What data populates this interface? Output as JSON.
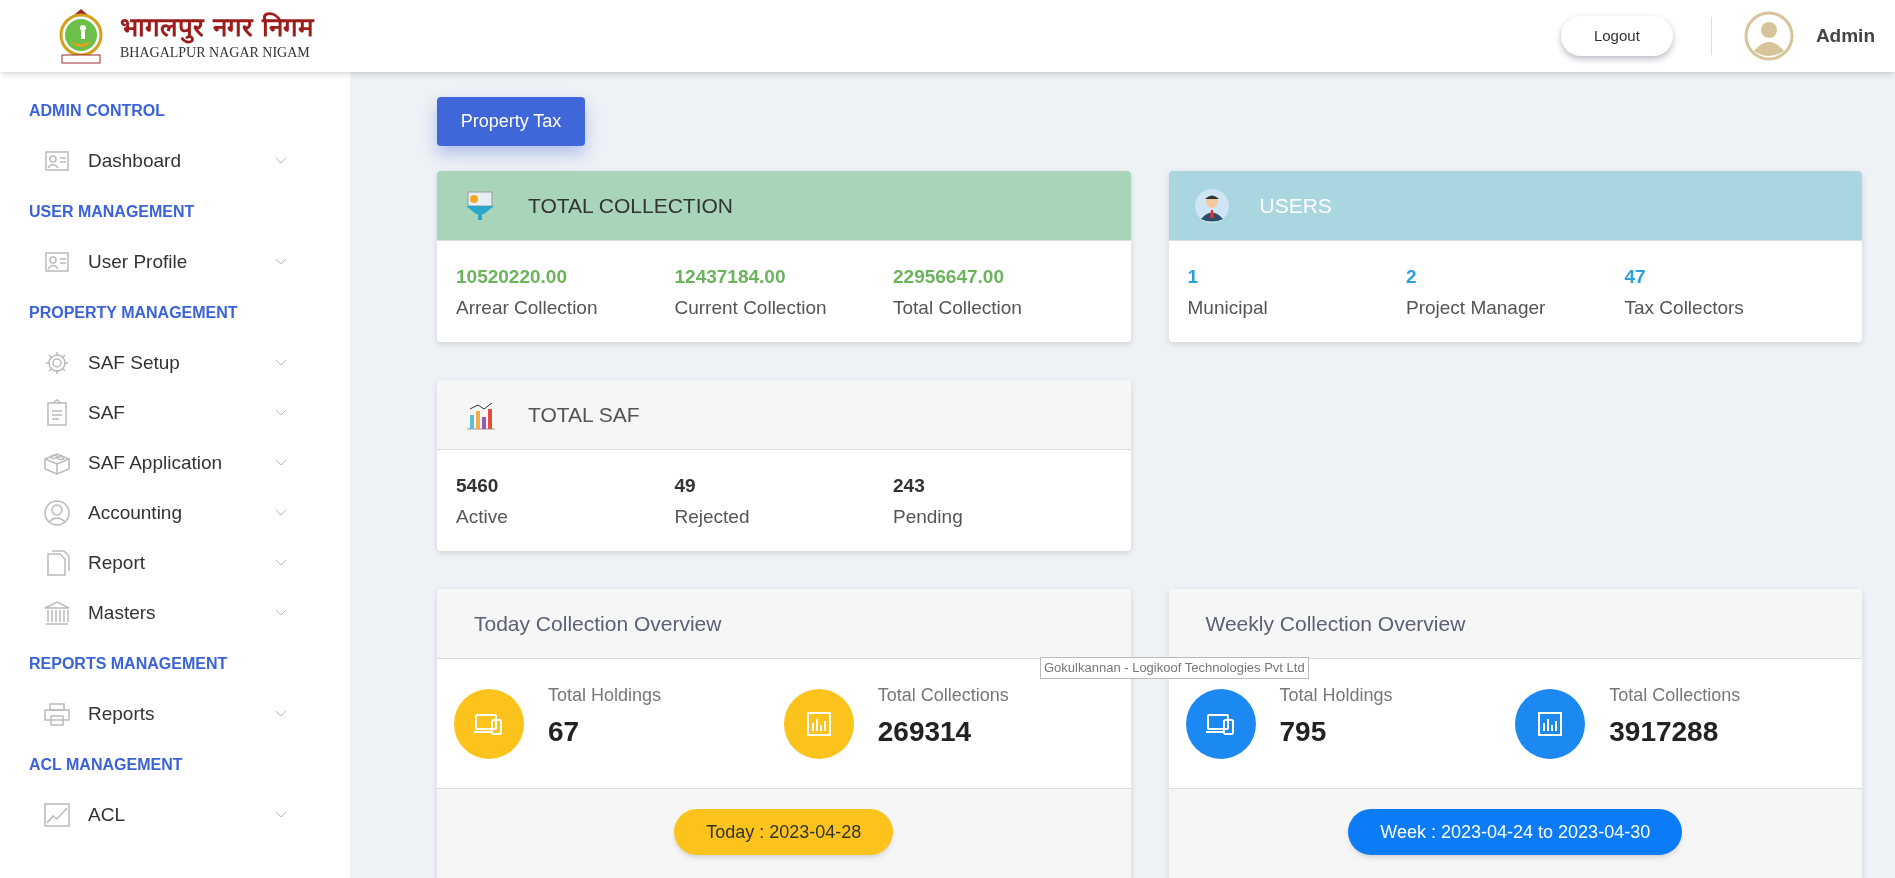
{
  "header": {
    "logo_hindi": "भागलपुर नगर निगम",
    "logo_english": "BHAGALPUR NAGAR NIGAM",
    "logout": "Logout",
    "user": "Admin"
  },
  "sidebar": [
    {
      "section": "ADMIN CONTROL",
      "items": [
        "Dashboard"
      ]
    },
    {
      "section": "USER MANAGEMENT",
      "items": [
        "User Profile"
      ]
    },
    {
      "section": "PROPERTY MANAGEMENT",
      "items": [
        "SAF Setup",
        "SAF",
        "SAF Application",
        "Accounting",
        "Report",
        "Masters"
      ]
    },
    {
      "section": "REPORTS MANAGEMENT",
      "items": [
        "Reports"
      ]
    },
    {
      "section": "ACL MANAGEMENT",
      "items": [
        "ACL"
      ]
    }
  ],
  "module_button": "Property Tax",
  "total_collection": {
    "title": "TOTAL COLLECTION",
    "stats": [
      {
        "value": "10520220.00",
        "label": "Arrear Collection"
      },
      {
        "value": "12437184.00",
        "label": "Current Collection"
      },
      {
        "value": "22956647.00",
        "label": "Total Collection"
      }
    ]
  },
  "users": {
    "title": "USERS",
    "stats": [
      {
        "value": "1",
        "label": "Municipal"
      },
      {
        "value": "2",
        "label": "Project Manager"
      },
      {
        "value": "47",
        "label": "Tax Collectors"
      }
    ]
  },
  "total_saf": {
    "title": "TOTAL SAF",
    "stats": [
      {
        "value": "5460",
        "label": "Active"
      },
      {
        "value": "49",
        "label": "Rejected"
      },
      {
        "value": "243",
        "label": "Pending"
      }
    ]
  },
  "today_overview": {
    "title": "Today Collection Overview",
    "stats": [
      {
        "label": "Total Holdings",
        "value": "67"
      },
      {
        "label": "Total Collections",
        "value": "269314"
      }
    ],
    "period": "Today : 2023-04-28"
  },
  "weekly_overview": {
    "title": "Weekly Collection Overview",
    "stats": [
      {
        "label": "Total Holdings",
        "value": "795"
      },
      {
        "label": "Total Collections",
        "value": "3917288"
      }
    ],
    "period": "Week : 2023-04-24 to 2023-04-30"
  },
  "tooltip": "Gokulkannan - Logikoof Technologies Pvt Ltd"
}
